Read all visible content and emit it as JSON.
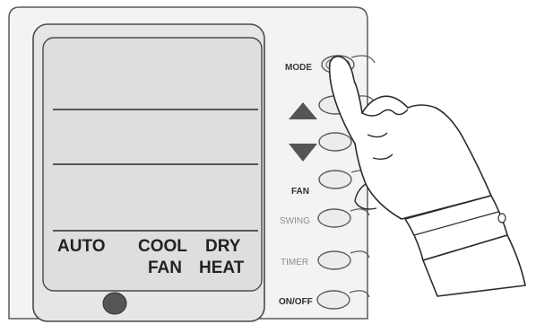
{
  "display": {
    "modes_row1": [
      "AUTO",
      "COOL",
      "DRY"
    ],
    "modes_row2": [
      "FAN",
      "HEAT"
    ]
  },
  "buttons": {
    "mode": "MODE",
    "up": "▲",
    "down": "▼",
    "fan": "FAN",
    "swing": "SWING",
    "timer": "TIMER",
    "onoff": "ON/OFF"
  },
  "colors": {
    "outline": "#5a5a5a",
    "body_fill": "#f3f3f3",
    "screen_fill": "#dedede",
    "arrow_fill": "#555555",
    "sensor_fill": "#555555",
    "dim_label": "#8c8c8c"
  },
  "icons": {
    "pointer": "hand-pointing-icon"
  }
}
